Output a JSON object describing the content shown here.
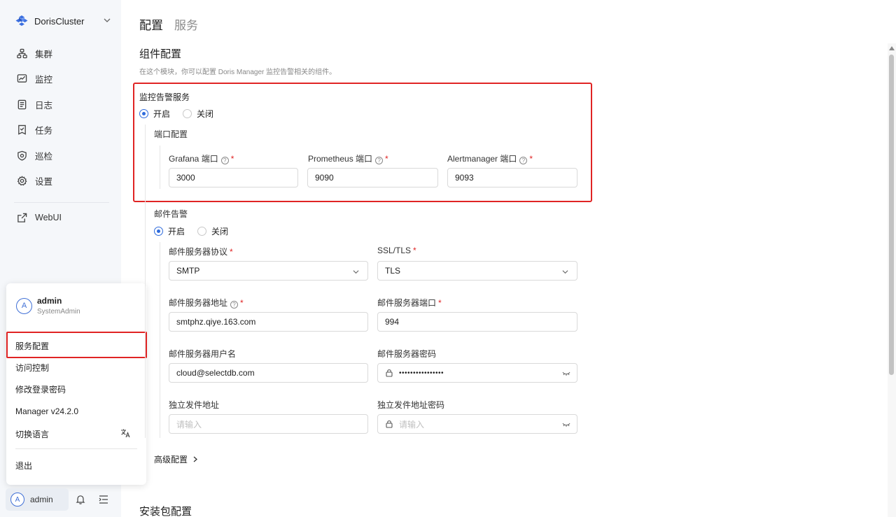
{
  "sidebar": {
    "cluster_name": "DorisCluster",
    "nav": [
      {
        "label": "集群",
        "icon": "cluster-icon"
      },
      {
        "label": "监控",
        "icon": "monitor-icon"
      },
      {
        "label": "日志",
        "icon": "log-icon"
      },
      {
        "label": "任务",
        "icon": "task-icon"
      },
      {
        "label": "巡检",
        "icon": "inspection-icon"
      },
      {
        "label": "设置",
        "icon": "gear-icon"
      }
    ],
    "webui_label": "WebUI"
  },
  "user_menu": {
    "avatar_letter": "A",
    "username": "admin",
    "role": "SystemAdmin",
    "items": [
      "服务配置",
      "访问控制",
      "修改登录密码",
      "Manager v24.2.0",
      "切换语言"
    ],
    "logout": "退出"
  },
  "bottom_bar": {
    "avatar_letter": "A",
    "username": "admin"
  },
  "tabs": [
    "配置",
    "服务"
  ],
  "component_config": {
    "title": "组件配置",
    "description": "在这个模块，你可以配置 Doris Manager 监控告警相关的组件。"
  },
  "monitoring": {
    "label": "监控告警服务",
    "radio_on": "开启",
    "radio_off": "关闭",
    "port_config_label": "端口配置",
    "grafana_label": "Grafana 端口",
    "grafana_value": "3000",
    "prometheus_label": "Prometheus 端口",
    "prometheus_value": "9090",
    "alertmanager_label": "Alertmanager 端口",
    "alertmanager_value": "9093"
  },
  "email": {
    "label": "邮件告警",
    "radio_on": "开启",
    "radio_off": "关闭",
    "protocol_label": "邮件服务器协议",
    "protocol_value": "SMTP",
    "ssl_label": "SSL/TLS",
    "ssl_value": "TLS",
    "host_label": "邮件服务器地址",
    "host_value": "smtphz.qiye.163.com",
    "port_label": "邮件服务器端口",
    "port_value": "994",
    "user_label": "邮件服务器用户名",
    "user_value": "cloud@selectdb.com",
    "password_label": "邮件服务器密码",
    "password_value": "••••••••••••••••",
    "sender_label": "独立发件地址",
    "sender_placeholder": "请输入",
    "sender_password_label": "独立发件地址密码",
    "sender_password_placeholder": "请输入"
  },
  "advanced_label": "高级配置",
  "package_config_title": "安装包配置"
}
